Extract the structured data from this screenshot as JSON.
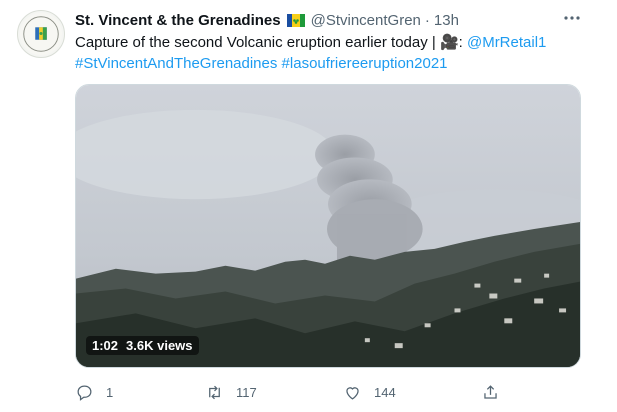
{
  "tweet": {
    "author_name": "St. Vincent & the Grenadines",
    "handle": "@StvincentGren",
    "separator": "·",
    "time": "13h",
    "text": {
      "line1_prefix": "Capture of the second Volcanic eruption earlier today | 🎥: ",
      "mention": "@MrRetail1",
      "hashtag1": "#StVincentAndTheGrenadines",
      "hashtag2": "#lasoufriereeruption2021"
    },
    "video": {
      "duration": "1:02",
      "views": "3.6K views"
    },
    "actions": {
      "reply_count": "1",
      "retweet_count": "117",
      "like_count": "144"
    }
  },
  "icons": {
    "avatar": "government-seal-avatar",
    "flag": "st-vincent-flag-icon",
    "more": "more-options-icon",
    "reply": "reply-icon",
    "retweet": "retweet-icon",
    "like": "heart-icon",
    "share": "share-icon"
  },
  "colors": {
    "link": "#1d9bf0",
    "secondary_text": "#536471",
    "primary_text": "#0f1419"
  }
}
